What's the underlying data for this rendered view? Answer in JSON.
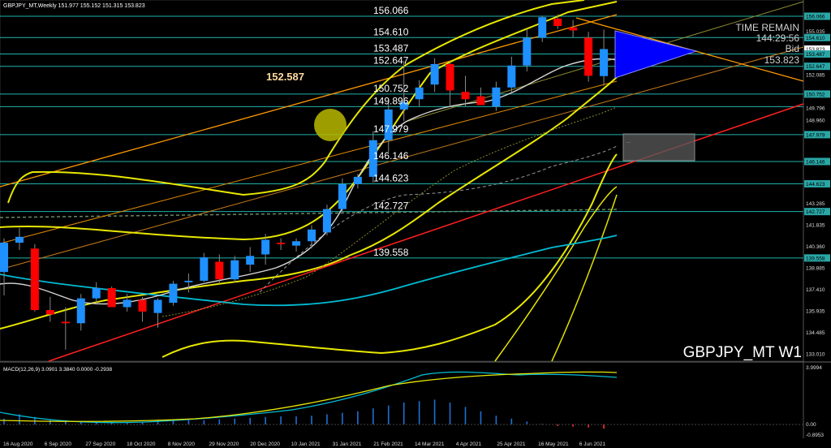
{
  "header": {
    "title": "GBPJPY_MT,Weekly  151.977 155.152 151.315 153.823"
  },
  "watermark": "GBPJPY_MT  W1",
  "timer": {
    "label": "TIME REMAIN",
    "value": "144:29:56",
    "bid_label": "Bid",
    "bid_value": "153.823"
  },
  "highlight_price": "152.587",
  "overlay_box_text": "...",
  "level_labels": [
    "156.066",
    "154.610",
    "153.487",
    "152.647",
    "150.752",
    "149.896",
    "147.979",
    "146.146",
    "144.623",
    "142.727",
    "139.558"
  ],
  "price_axis": [
    "156.066",
    "155.035",
    "154.610",
    "153.823",
    "153.487",
    "152.647",
    "152.085",
    "150.752",
    "149.796",
    "148.960",
    "147.979",
    "146.146",
    "144.623",
    "143.285",
    "142.727",
    "141.835",
    "140.360",
    "139.558",
    "138.885",
    "137.410",
    "135.935",
    "134.485",
    "133.010"
  ],
  "macd_label": "MACD(12,26,9) 3.0901 3.3840 0.0000 -0.2938",
  "macd_axis": [
    "3.9994",
    "0.00",
    "-0.8953"
  ],
  "time_axis": [
    "16 Aug 2020",
    "6 Sep 2020",
    "27 Sep 2020",
    "18 Oct 2020",
    "8 Nov 2020",
    "29 Nov 2020",
    "20 Dec 2020",
    "10 Jan 2021",
    "31 Jan 2021",
    "21 Feb 2021",
    "14 Mar 2021",
    "4 Apr 2021",
    "25 Apr 2021",
    "16 May 2021",
    "6 Jun 2021"
  ],
  "colors": {
    "background": "#000000",
    "bull_candle": "#1e90ff",
    "bear_candle": "#ff0000",
    "level_line": "#20b2aa",
    "trend_red": "#ff0000",
    "channel_orange": "#ffa500",
    "band_yellow": "#ffff00",
    "ma_cyan": "#00bcd4",
    "triangle_fill": "#0000ff",
    "circle": "#b8b800"
  }
}
